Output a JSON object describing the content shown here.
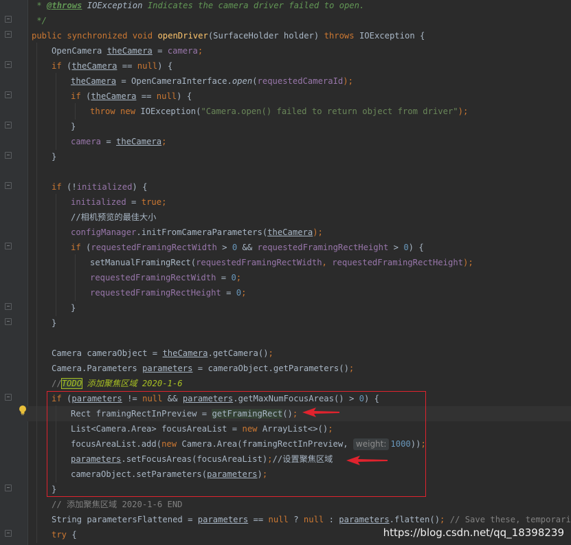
{
  "editor": {
    "watermark": "https://blog.csdn.net/qq_18398239",
    "param_hint": "weight:",
    "lines": {
      "l01": {
        "star": " * ",
        "tag": "@throws",
        "type": " IOException",
        "text": " Indicates the camera driver failed to open."
      },
      "l02": {
        "end": " */"
      },
      "l03": {
        "kw": "public synchronized void ",
        "method": "openDriver",
        "rest": "(SurfaceHolder holder) ",
        "throws": "throws",
        "rest2": " IOException {"
      },
      "l04": {
        "a": "OpenCamera ",
        "b": "theCamera",
        "c": " = ",
        "d": "camera",
        "e": ";"
      },
      "l05": {
        "a": "if",
        "b": " (",
        "c": "theCamera",
        "d": " == ",
        "e": "null",
        "f": ") {"
      },
      "l06": {
        "a": "theCamera",
        "b": " = OpenCameraInterface.",
        "c": "open",
        "d": "(",
        "e": "requestedCameraId",
        "f": ");"
      },
      "l07": {
        "a": "if",
        "b": " (",
        "c": "theCamera",
        "d": " == ",
        "e": "null",
        "f": ") {"
      },
      "l08": {
        "a": "throw new",
        "b": " IOException(",
        "c": "\"Camera.open() failed to return object from driver\"",
        "d": ");"
      },
      "l09": {
        "a": "}"
      },
      "l10": {
        "a": "camera",
        "b": " = ",
        "c": "theCamera",
        "d": ";"
      },
      "l11": {
        "a": "}"
      },
      "l12": {
        "a": "if",
        "b": " (!",
        "c": "initialized",
        "d": ") {"
      },
      "l13": {
        "a": "initialized",
        "b": " = ",
        "c": "true",
        "d": ";"
      },
      "l14": {
        "a": "//相机预览的最佳大小"
      },
      "l15": {
        "a": "configManager",
        "b": ".initFromCameraParameters(",
        "c": "theCamera",
        "d": ");"
      },
      "l16": {
        "a": "if",
        "b": " (",
        "c": "requestedFramingRectWidth",
        "d": " > ",
        "e": "0",
        "f": " && ",
        "g": "requestedFramingRectHeight",
        "h": " > ",
        "i": "0",
        "j": ") {"
      },
      "l17": {
        "a": "setManualFramingRect(",
        "b": "requestedFramingRectWidth",
        "c": ", ",
        "d": "requestedFramingRectHeight",
        "e": ");"
      },
      "l18": {
        "a": "requestedFramingRectWidth",
        "b": " = ",
        "c": "0",
        "d": ";"
      },
      "l19": {
        "a": "requestedFramingRectHeight",
        "b": " = ",
        "c": "0",
        "d": ";"
      },
      "l20": {
        "a": "}"
      },
      "l21": {
        "a": "}"
      },
      "l22": {
        "a": "Camera cameraObject = ",
        "b": "theCamera",
        "c": ".getCamera()",
        "d": ";"
      },
      "l23": {
        "a": "Camera.Parameters ",
        "b": "parameters",
        "c": " = cameraObject.getParameters()",
        "d": ";"
      },
      "l24": {
        "a": "//",
        "b": "TODO",
        "c": " 添加聚焦区域 2020-1-6"
      },
      "l25": {
        "a": "if",
        "b": " (",
        "c": "parameters",
        "d": " != ",
        "e": "null",
        "f": " && ",
        "g": "parameters",
        "h": ".getMaxNumFocusAreas() > ",
        "i": "0",
        "j": ") {"
      },
      "l26": {
        "a": "Rect framingRectInPreview = ",
        "b": "getFramingRect",
        "c": "()",
        "d": ";"
      },
      "l27": {
        "a": "List<Camera.Area> focusAreaList = ",
        "b": "new",
        "c": " ArrayList<>()",
        "d": ";"
      },
      "l28": {
        "a": "focusAreaList.add(",
        "b": "new",
        "c": " Camera.Area(framingRectInPreview, ",
        "d": "1000",
        "e": "))",
        "f": ";"
      },
      "l29": {
        "a": "parameters",
        "b": ".setFocusAreas(focusAreaList)",
        "c": ";",
        "d": "//设置聚焦区域"
      },
      "l30": {
        "a": "cameraObject.setParameters(",
        "b": "parameters",
        "c": ")",
        "d": ";"
      },
      "l31": {
        "a": "}"
      },
      "l32": {
        "a": "// 添加聚焦区域 2020-1-6 END"
      },
      "l33": {
        "a": "String parametersFlattened = ",
        "b": "parameters",
        "c": " == ",
        "d": "null",
        "e": " ? ",
        "f": "null",
        "g": " : ",
        "h": "parameters",
        "i": ".flatten()",
        "j": ";",
        "k": " // Save these, temporarily"
      },
      "l34": {
        "a": "try",
        "b": " {"
      }
    }
  },
  "colors": {
    "background": "#2b2b2b",
    "keyword": "#cc7832",
    "field": "#9876aa",
    "string": "#6a8759",
    "number": "#6897bb",
    "method_decl": "#ffc66d",
    "comment": "#808080",
    "doc_comment": "#629755",
    "annotation_box": "#e0232e",
    "todo": "#a8c023"
  }
}
